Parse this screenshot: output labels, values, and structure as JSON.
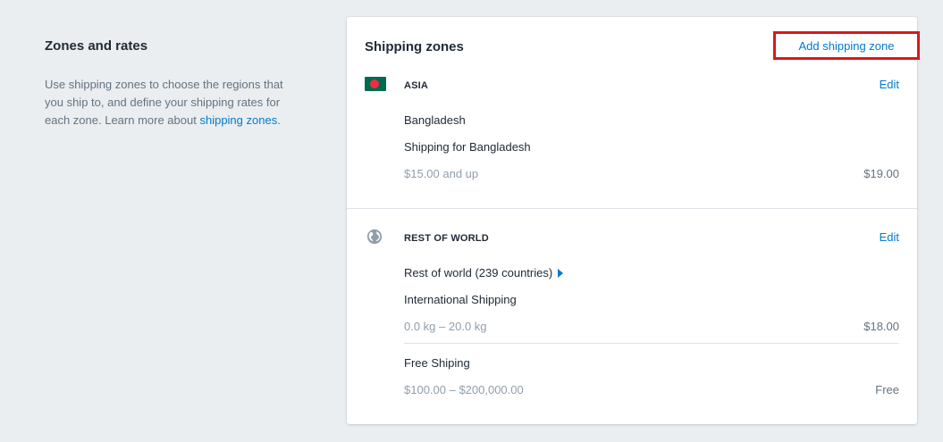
{
  "section": {
    "title": "Zones and rates",
    "description": "Use shipping zones to choose the regions that you ship to, and define your shipping rates for each zone. Learn more about",
    "link_text": "shipping zones",
    "link_suffix": "."
  },
  "card": {
    "title": "Shipping zones",
    "add_button": "Add shipping zone"
  },
  "zones": [
    {
      "name": "ASIA",
      "icon": "bangladesh-flag-icon",
      "edit_label": "Edit",
      "countries": "Bangladesh",
      "rates": [
        {
          "name": "Shipping for Bangladesh",
          "condition": "$15.00 and up",
          "price": "$19.00"
        }
      ]
    },
    {
      "name": "REST OF WORLD",
      "icon": "globe-icon",
      "edit_label": "Edit",
      "countries": "Rest of world (239 countries)",
      "rates": [
        {
          "name": "International Shipping",
          "condition": "0.0 kg – 20.0 kg",
          "price": "$18.00"
        },
        {
          "name": "Free Shiping",
          "condition": "$100.00 – $200,000.00",
          "price": "Free"
        }
      ]
    }
  ],
  "colors": {
    "link": "#007ace",
    "highlight_border": "#d7191c",
    "flag_green": "#006a4e",
    "flag_red": "#f42a41"
  }
}
